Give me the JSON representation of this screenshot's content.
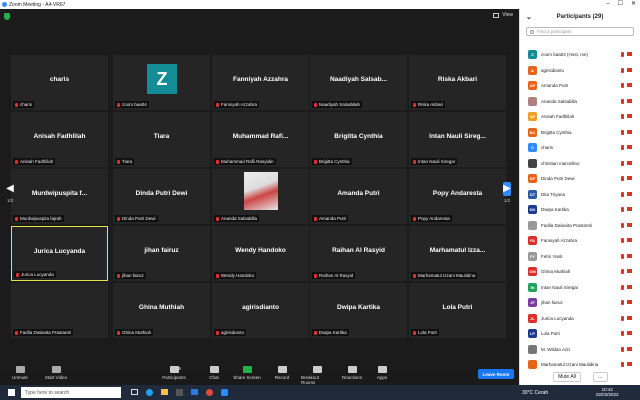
{
  "window": {
    "title": "Zoom Meeting - A4-VR67"
  },
  "view": {
    "label": "View"
  },
  "grid": [
    {
      "name": "charis",
      "label": "charis"
    },
    {
      "name": "",
      "label": "zoom baa04",
      "avatar": "Z"
    },
    {
      "name": "Fanniyah Azzahra",
      "label": "Fanniyah Azzahra"
    },
    {
      "name": "Naadiyah Salsab...",
      "label": "Naadiyah Salsabilah"
    },
    {
      "name": "Riska Akbari",
      "label": "Riska Akbari"
    },
    {
      "name": "Anisah Fadhlilah",
      "label": "Anisah Fadhlilah"
    },
    {
      "name": "Tiara",
      "label": "Tiara"
    },
    {
      "name": "Muhammad Rafi...",
      "label": "Muhammad Rafii Rasyidin"
    },
    {
      "name": "Brigitta Cynthia",
      "label": "Brigitta Cynthia"
    },
    {
      "name": "Intan Nauli Sireg...",
      "label": "Intan Nauli Siregar"
    },
    {
      "name": "Murdwipuspita f...",
      "label": "Murdwipuspita fajrah"
    },
    {
      "name": "Dinda Putri Dewi",
      "label": "Dinda Putri Dewi"
    },
    {
      "name": "",
      "label": "Ananda Salsabilla",
      "photo": true
    },
    {
      "name": "Amanda Putri",
      "label": "Amanda Putri"
    },
    {
      "name": "Popy Andaresta",
      "label": "Popy Andaresta"
    },
    {
      "name": "Jurica Lucyanda",
      "label": "Jurica Lucyanda",
      "active": true
    },
    {
      "name": "jihan fairuz",
      "label": "jihan fairuz"
    },
    {
      "name": "Wendy Handoko",
      "label": "Wendy Handoko"
    },
    {
      "name": "Raihan Al Rasyid",
      "label": "Raihan Al Rasyid"
    },
    {
      "name": "Marhamatul Izza...",
      "label": "Marhamatul Izzani Maulidina"
    },
    {
      "name": "",
      "label": "Fadila Dwianita Prastantri"
    },
    {
      "name": "Ghina Muthiah",
      "label": "Ghina Muthiah"
    },
    {
      "name": "agirisdianto",
      "label": "agirisdianto"
    },
    {
      "name": "Dwipa Kartika",
      "label": "Dwipa Kartika"
    },
    {
      "name": "Lola Putri",
      "label": "Lola Putri"
    }
  ],
  "pager": {
    "left": "1/2",
    "right": "1/2"
  },
  "toolbar": {
    "unmute": "Unmute",
    "start_video": "Start Video",
    "participants": "Participants",
    "participants_count": "29",
    "chat": "Chat",
    "share": "Share Screen",
    "record": "Record",
    "breakout": "Breakout Rooms",
    "reactions": "Reactions",
    "apps": "Apps",
    "leave": "Leave Room"
  },
  "panel": {
    "title": "Participants (29)",
    "search_placeholder": "Find a participant",
    "mute_all": "Mute All",
    "items": [
      {
        "initials": "Z",
        "name": "zoom baa04 (Host, me)",
        "color": "#138c96"
      },
      {
        "initials": "A",
        "name": "agirisdianto",
        "color": "#e8641b"
      },
      {
        "initials": "AP",
        "name": "Amanda Putri",
        "color": "#e8641b"
      },
      {
        "initials": "",
        "name": "Ananda Salsabilla",
        "color": "#b08080",
        "photo": true
      },
      {
        "initials": "AF",
        "name": "Anisah Fadhlilah",
        "color": "#f0a020"
      },
      {
        "initials": "BC",
        "name": "Brigitta Cynthia",
        "color": "#e8641b"
      },
      {
        "initials": "C",
        "name": "charis",
        "color": "#2d8cff"
      },
      {
        "initials": "",
        "name": "christian marcellino",
        "color": "#444",
        "photo": true
      },
      {
        "initials": "DP",
        "name": "Dinda Putri Dewi",
        "color": "#e8641b"
      },
      {
        "initials": "DT",
        "name": "Dita Triyana",
        "color": "#2d5aa0"
      },
      {
        "initials": "DK",
        "name": "Dwipa Kartika",
        "color": "#1e3a8a"
      },
      {
        "initials": "",
        "name": "Fadila Dwianita Prastantri",
        "color": "#999",
        "photo": true
      },
      {
        "initials": "FA",
        "name": "Fanniyah Azzahra",
        "color": "#d9302a"
      },
      {
        "initials": "FY",
        "name": "Febri Yanti",
        "color": "#999"
      },
      {
        "initials": "GM",
        "name": "Ghina Muthiah",
        "color": "#d9302a"
      },
      {
        "initials": "IN",
        "name": "Intan Nauli Siregar",
        "color": "#23a05a"
      },
      {
        "initials": "JF",
        "name": "jihan fairuz",
        "color": "#7a3aa0"
      },
      {
        "initials": "JL",
        "name": "Jurica Lucyanda",
        "color": "#d9302a"
      },
      {
        "initials": "LP",
        "name": "Lola Putri",
        "color": "#1e3a8a"
      },
      {
        "initials": "",
        "name": "M. Wildan Aziz",
        "color": "#777",
        "photo": true
      },
      {
        "initials": "",
        "name": "Marhamatul Izzani Maulidina",
        "color": "#e8641b",
        "photo": true
      }
    ]
  },
  "taskbar": {
    "search_placeholder": "Type here to search",
    "weather": "30°C Cerah",
    "time": "10:42",
    "date": "02/03/2022"
  }
}
